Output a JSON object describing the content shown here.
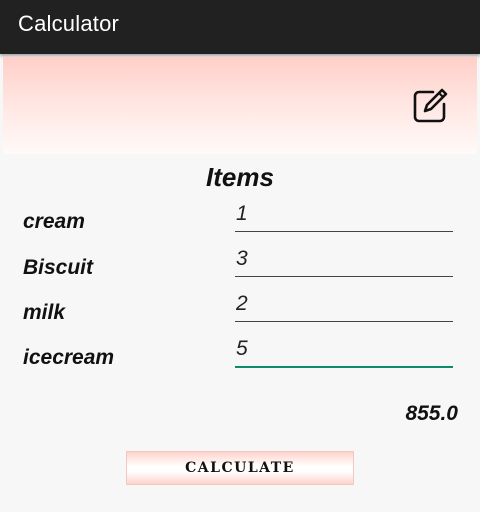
{
  "app": {
    "title": "Calculator"
  },
  "banner": {
    "edit_icon": "edit-icon"
  },
  "items": {
    "title": "Items",
    "rows": [
      {
        "label": "cream",
        "value": "1"
      },
      {
        "label": "Biscuit",
        "value": "3"
      },
      {
        "label": "milk",
        "value": "2"
      },
      {
        "label": "icecream",
        "value": "5"
      }
    ]
  },
  "result": {
    "total": "855.0"
  },
  "actions": {
    "calculate_label": "CALCULATE"
  },
  "colors": {
    "accent": "#0e8a6e",
    "appbar": "#212121",
    "banner": "#ffcfc8"
  }
}
